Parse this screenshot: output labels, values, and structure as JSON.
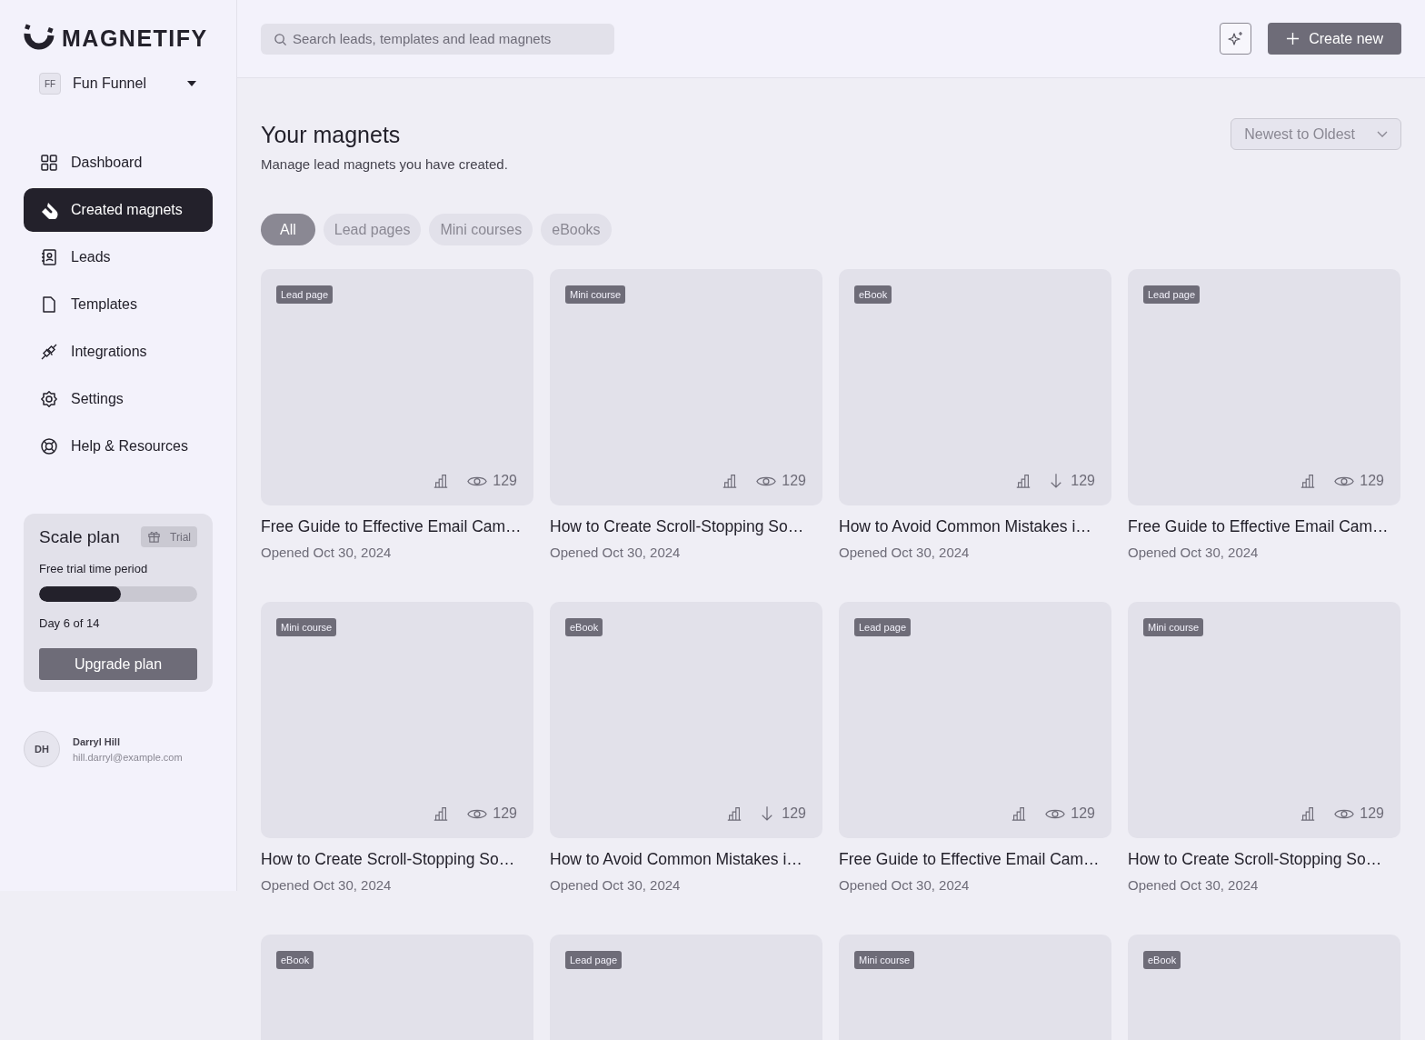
{
  "logo": {
    "text": "MAGNETIFY"
  },
  "workspace": {
    "initials": "FF",
    "name": "Fun Funnel"
  },
  "nav": [
    {
      "label": "Dashboard",
      "selected": false
    },
    {
      "label": "Created magnets",
      "selected": true
    },
    {
      "label": "Leads",
      "selected": false
    },
    {
      "label": "Templates",
      "selected": false
    },
    {
      "label": "Integrations",
      "selected": false
    },
    {
      "label": "Settings",
      "selected": false
    },
    {
      "label": "Help & Resources",
      "selected": false
    }
  ],
  "plan": {
    "title": "Scale plan",
    "badge": "Trial",
    "caption": "Free trial time period",
    "level": 0.52,
    "progress_text": "Day 6 of 14",
    "button": "Upgrade plan"
  },
  "user": {
    "initials": "DH",
    "name": "Darryl Hill",
    "email": "hill.darryl@example.com"
  },
  "search": {
    "placeholder": "Search leads, templates and lead magnets"
  },
  "create_button": "Create new",
  "page": {
    "title": "Your magnets",
    "subtitle": "Manage lead magnets you have created.",
    "sort": "Newest to Oldest"
  },
  "filters": [
    {
      "label": "All",
      "selected": true
    },
    {
      "label": "Lead pages",
      "selected": false
    },
    {
      "label": "Mini courses",
      "selected": false
    },
    {
      "label": "eBooks",
      "selected": false
    }
  ],
  "cards": [
    {
      "tag": "Lead page",
      "kind": "views",
      "count": "129",
      "title": "Free Guide to Effective Email Cam…",
      "opened": "Opened Oct 30, 2024"
    },
    {
      "tag": "Mini course",
      "kind": "views",
      "count": "129",
      "title": "How to Create Scroll-Stopping So…",
      "opened": "Opened Oct 30, 2024"
    },
    {
      "tag": "eBook",
      "kind": "downloads",
      "count": "129",
      "title": "How to Avoid Common Mistakes i…",
      "opened": "Opened Oct 30, 2024"
    },
    {
      "tag": "Lead page",
      "kind": "views",
      "count": "129",
      "title": "Free Guide to Effective Email Cam…",
      "opened": "Opened Oct 30, 2024"
    },
    {
      "tag": "Mini course",
      "kind": "views",
      "count": "129",
      "title": "How to Create Scroll-Stopping So…",
      "opened": "Opened Oct 30, 2024"
    },
    {
      "tag": "eBook",
      "kind": "downloads",
      "count": "129",
      "title": "How to Avoid Common Mistakes i…",
      "opened": "Opened Oct 30, 2024"
    },
    {
      "tag": "Lead page",
      "kind": "views",
      "count": "129",
      "title": "Free Guide to Effective Email Cam…",
      "opened": "Opened Oct 30, 2024"
    },
    {
      "tag": "Mini course",
      "kind": "views",
      "count": "129",
      "title": "How to Create Scroll-Stopping So…",
      "opened": "Opened Oct 30, 2024"
    },
    {
      "tag": "eBook"
    },
    {
      "tag": "Lead page"
    },
    {
      "tag": "Mini course"
    },
    {
      "tag": "eBook"
    }
  ]
}
